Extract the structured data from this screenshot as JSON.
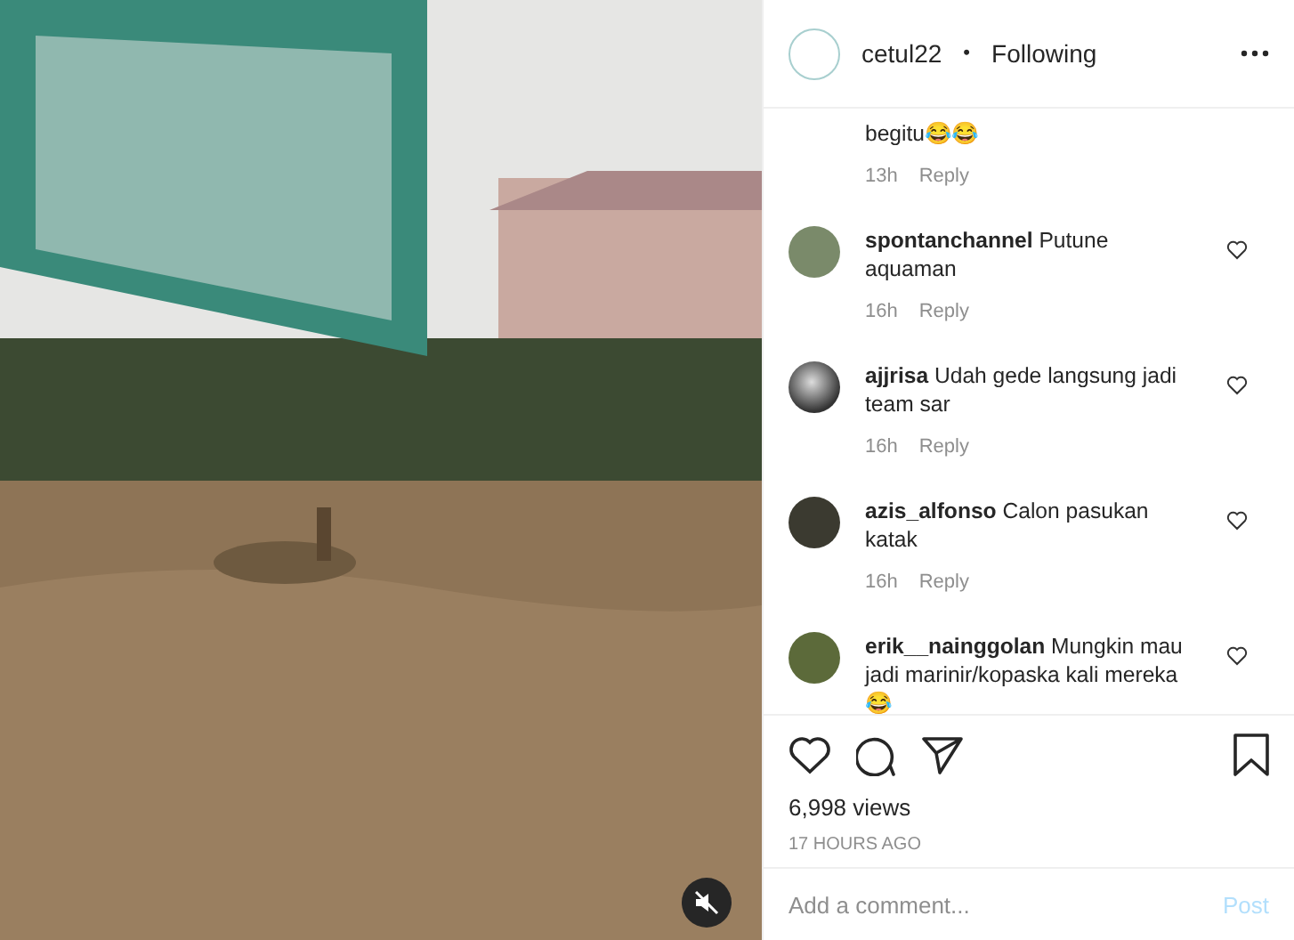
{
  "video": {
    "muted": true
  },
  "header": {
    "username": "cetul22",
    "separator": "•",
    "follow_status": "Following"
  },
  "comments": [
    {
      "text": "begitu😂😂",
      "time": "13h",
      "reply": "Reply"
    },
    {
      "username": "spontanchannel",
      "text": "Putune aquaman",
      "time": "16h",
      "reply": "Reply"
    },
    {
      "username": "ajjrisa",
      "text": "Udah gede langsung jadi team sar",
      "time": "16h",
      "reply": "Reply"
    },
    {
      "username": "azis_alfonso",
      "text": "Calon pasukan katak",
      "time": "16h",
      "reply": "Reply"
    },
    {
      "username": "erik__nainggolan",
      "text": "Mungkin mau jadi marinir/kopaska kali mereka 😂"
    }
  ],
  "views": "6,998 views",
  "posted": "17 HOURS AGO",
  "add_comment": {
    "placeholder": "Add a comment...",
    "button": "Post",
    "disabled": true
  }
}
